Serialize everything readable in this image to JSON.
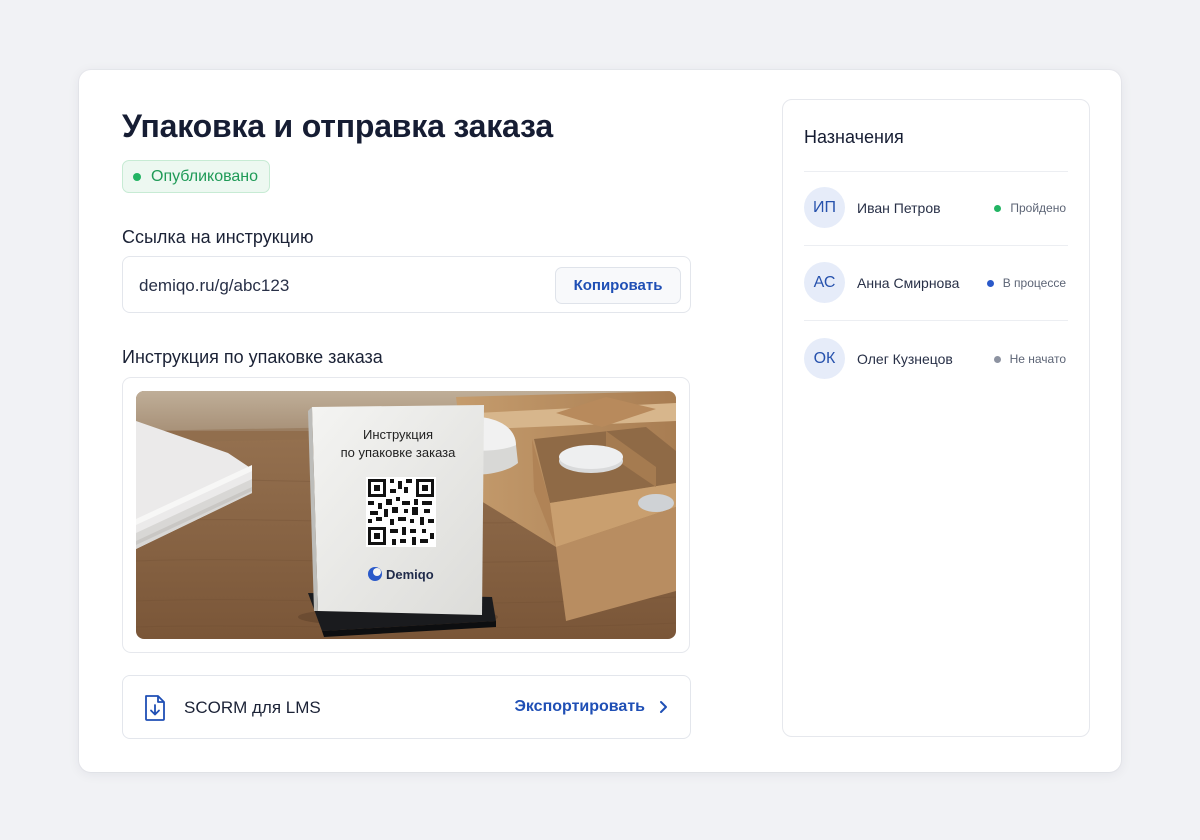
{
  "page": {
    "title": "Упаковка и отправка заказа",
    "status_badge": "Опубликовано"
  },
  "link_section": {
    "label": "Ссылка на инструкцию",
    "url": "demiqo.ru/g/abc123",
    "copy_label": "Копировать"
  },
  "preview": {
    "label": "Инструкция по упаковке заказа",
    "sign_line1": "Инструкция",
    "sign_line2": "по упаковке заказа",
    "brand": "Demiqo"
  },
  "export": {
    "label": "SCORM для LMS",
    "action_label": "Экспортировать"
  },
  "assignments": {
    "title": "Назначения",
    "items": [
      {
        "initials": "ИП",
        "name": "Иван Петров",
        "status": "Пройдено",
        "status_color": "#22b463"
      },
      {
        "initials": "АС",
        "name": "Анна Смирнова",
        "status": "В процессе",
        "status_color": "#2a59c9"
      },
      {
        "initials": "ОК",
        "name": "Олег Кузнецов",
        "status": "Не начато",
        "status_color": "#8d93a1"
      }
    ]
  },
  "colors": {
    "accent": "#1f4fb5",
    "success": "#22b463",
    "background": "#f1f2f5"
  },
  "icons": {
    "export": "file-download-icon",
    "chevron": "chevron-right-icon"
  }
}
